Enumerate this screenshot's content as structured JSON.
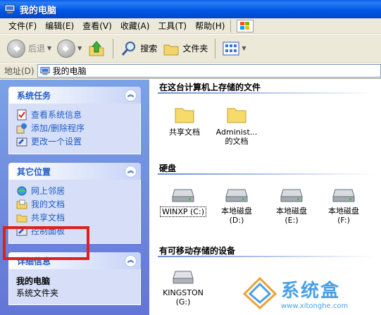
{
  "window": {
    "title": "我的电脑"
  },
  "menu": [
    "文件(F)",
    "编辑(E)",
    "查看(V)",
    "收藏(A)",
    "工具(T)",
    "帮助(H)"
  ],
  "toolbar": {
    "back_label": "后退",
    "search_label": "搜索",
    "folders_label": "文件夹"
  },
  "address": {
    "label": "地址(D)",
    "value": "我的电脑"
  },
  "left": {
    "system_tasks": {
      "title": "系统任务",
      "items": [
        "查看系统信息",
        "添加/删除程序",
        "更改一个设置"
      ]
    },
    "other_places": {
      "title": "其它位置",
      "items": [
        "网上邻居",
        "我的文档",
        "共享文档",
        "控制面板"
      ]
    },
    "details": {
      "title": "详细信息",
      "name": "我的电脑",
      "type": "系统文件夹"
    }
  },
  "right": {
    "stored_files": {
      "title": "在这台计算机上存储的文件",
      "items": [
        "共享文档",
        "Administ...\n的文档"
      ]
    },
    "hard_disks": {
      "title": "硬盘",
      "items": [
        "WINXP (C:)",
        "本地磁盘\n(D:)",
        "本地磁盘\n(E:)",
        "本地磁盘\n(F:)"
      ]
    },
    "removable": {
      "title": "有可移动存储的设备",
      "items": [
        "KINGSTON\n(G:)"
      ]
    }
  },
  "watermark": {
    "brand": "系统盒",
    "url": "www.xitonghe.com"
  },
  "colors": {
    "title_bar": "#0058e6",
    "link": "#215dc6",
    "highlight_box": "#e0201b"
  }
}
